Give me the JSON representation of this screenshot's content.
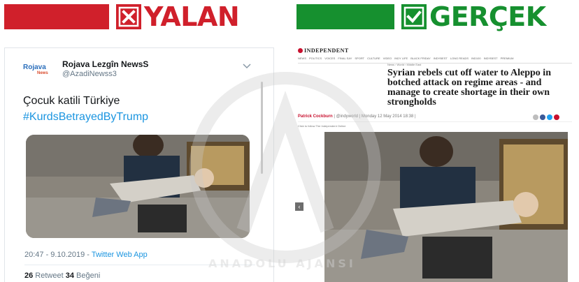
{
  "banner_left": {
    "label": "YALAN",
    "badge_icon": "x-mark-icon",
    "color": "#d0202b"
  },
  "banner_right": {
    "label": "GERÇEK",
    "badge_icon": "check-mark-icon",
    "color": "#16902f"
  },
  "tweet": {
    "avatar_text": "Rojava",
    "avatar_subtext": "News",
    "display_name": "Rojava Lezgîn NewsS",
    "handle": "@AzadiNewss3",
    "text": "Çocuk katili Türkiye",
    "hashtag": "#KurdsBetrayedByTrump",
    "timestamp": "20:47 - 9.10.2019 - ",
    "via": "Twitter Web App",
    "retweet_count": "26",
    "retweet_label": " Retweet ",
    "like_count": "34",
    "like_label": " Beğeni"
  },
  "article": {
    "masthead": "INDEPENDENT",
    "nav_items": [
      "NEWS",
      "POLITICS",
      "VOICES",
      "FINAL SAY",
      "SPORT",
      "CULTURE",
      "VIDEO",
      "INDY LIFE",
      "BLACK FRIDAY",
      "INDYBEST",
      "LONG READS",
      "IND100",
      "INDYBEST",
      "PREMIUM"
    ],
    "breadcrumb": "News › World › Middle East",
    "headline": "Syrian rebels cut off water to Aleppo in botched attack on regime areas - and manage to create shortage in their own strongholds",
    "author": "Patrick Cockburn",
    "byline_rest": " | @indyworld | Monday 12 May 2014 18:38 | ",
    "subline": "Click to follow The Independent Online",
    "prev_label": "‹"
  },
  "watermark": {
    "text": "ANADOLU AJANSI"
  }
}
